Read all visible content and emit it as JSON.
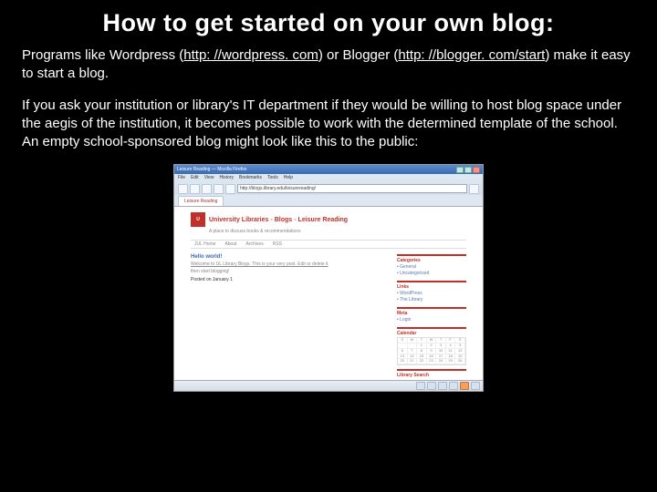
{
  "title": "How to get started on your own blog:",
  "para1_a": "Programs like Wordpress (",
  "link1_text": "http: //wordpress. com",
  "para1_b": ") or Blogger (",
  "link2_text": "http: //blogger. com/start",
  "para1_c": ") make it easy to start a blog.",
  "para2": "If you ask your institution or library's IT department if they would be willing to host blog space under the aegis of the institution, it becomes possible to work with the determined template of the school.  An empty school-sponsored blog might look like this to the public:",
  "browser": {
    "title": "Leisure Reading — Mozilla Firefox",
    "url": "http://blogs.library.edu/leisurereading/",
    "tab": "Leisure Reading"
  },
  "blog": {
    "crumb": "University Libraries  ◦  Blogs  ◦  Leisure Reading",
    "subhead": "A place to discuss books & recommendations",
    "nav": [
      "JUL Home",
      "About",
      "Archives",
      "RSS"
    ],
    "post": {
      "title": "Hello world!",
      "meta": "Welcome to UL Library Blogs. This is your very post. Edit or delete it",
      "author": "then start blogging!",
      "body": "Posted on January 1"
    },
    "side": {
      "categories": {
        "title": "Categories",
        "items": [
          "General",
          "Uncategorized"
        ]
      },
      "links": {
        "title": "Links",
        "items": [
          "WordPress",
          "The Library"
        ]
      },
      "meta": {
        "title": "Meta",
        "items": [
          "Login"
        ]
      },
      "calendar": {
        "title": "Calendar"
      },
      "search": {
        "title": "Library Search"
      }
    }
  }
}
